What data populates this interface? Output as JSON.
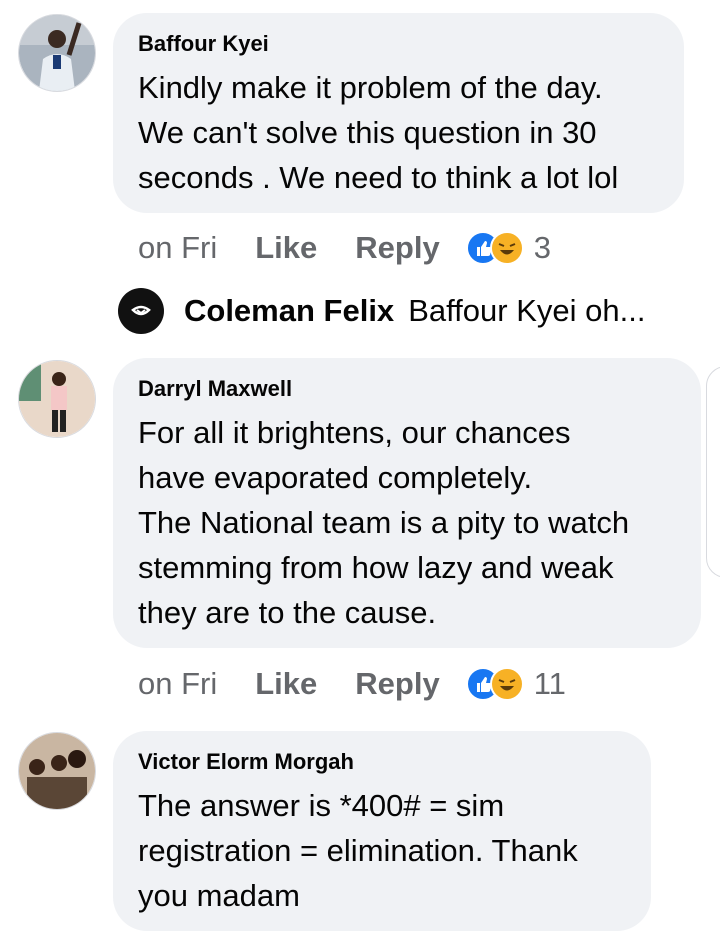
{
  "comments": [
    {
      "author": "Baffour Kyei",
      "text": "Kindly make it problem of the day.\nWe can't solve this question in 30\nseconds . We need to think a lot lol",
      "time": "on Fri",
      "like_label": "Like",
      "reply_label": "Reply",
      "reaction_count": "3"
    },
    {
      "author": "Darryl Maxwell",
      "text": "For all it brightens, our chances\nhave evaporated completely.\nThe National team is a pity to watch\nstemming from how lazy and weak\nthey are to the cause.",
      "time": "on Fri",
      "like_label": "Like",
      "reply_label": "Reply",
      "reaction_count": "11"
    },
    {
      "author": "Victor Elorm Morgah",
      "text": "The answer is *400# = sim\nregistration = elimination. Thank\nyou madam"
    }
  ],
  "reply_preview": {
    "author": "Coleman Felix",
    "snippet": "Baffour Kyei oh..."
  },
  "icons": {
    "like_reaction": "thumbs-up-reaction-icon",
    "laugh_reaction": "laugh-reaction-icon"
  },
  "colors": {
    "bubble": "#f0f2f5",
    "secondary_text": "#65676b",
    "like_blue": "#1877f2",
    "emoji_yellow": "#f7b125"
  }
}
